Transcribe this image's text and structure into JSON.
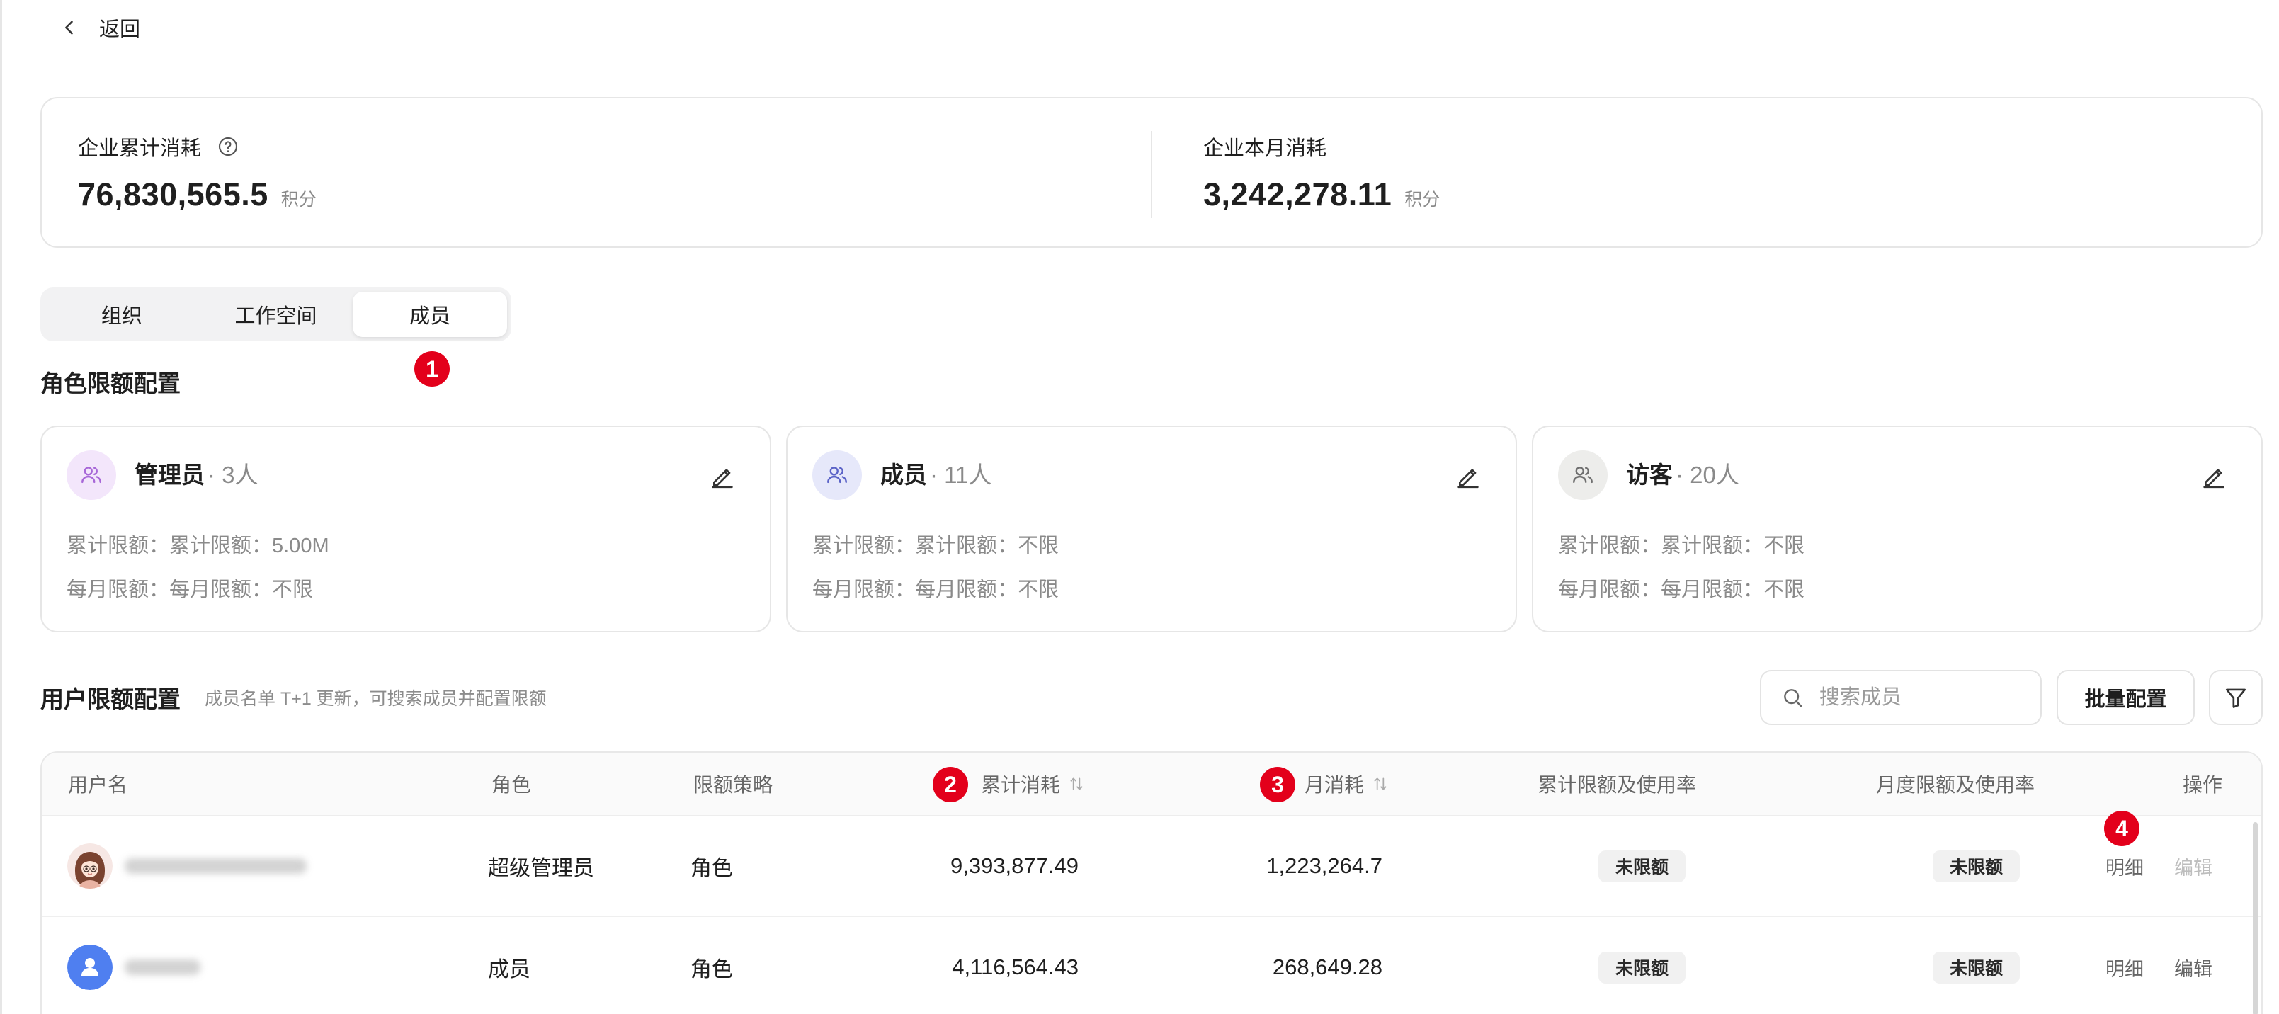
{
  "header": {
    "back_label": "返回",
    "back_icon": "chevron-left-icon"
  },
  "summary": {
    "total": {
      "label": "企业累计消耗",
      "value": "76,830,565.5",
      "unit": "积分",
      "help_icon": "help-circle-icon"
    },
    "monthly": {
      "label": "企业本月消耗",
      "value": "3,242,278.11",
      "unit": "积分"
    }
  },
  "tabs": [
    {
      "label": "组织",
      "active": false
    },
    {
      "label": "工作空间",
      "active": false
    },
    {
      "label": "成员",
      "active": true
    }
  ],
  "roles_section": {
    "title": "角色限额配置"
  },
  "roles": [
    {
      "name": "管理员",
      "count": "· 3人",
      "total_limit": "累计限额：累计限额：5.00M",
      "monthly_limit": "每月限额：每月限额：不限",
      "icon": "users-icon",
      "icon_bg": "#f3e6fb",
      "icon_color": "#a868d8"
    },
    {
      "name": "成员",
      "count": "· 11人",
      "total_limit": "累计限额：累计限额：不限",
      "monthly_limit": "每月限额：每月限额：不限",
      "icon": "users-icon",
      "icon_bg": "#e6e8fa",
      "icon_color": "#5b63c7"
    },
    {
      "name": "访客",
      "count": "· 20人",
      "total_limit": "累计限额：累计限额：不限",
      "monthly_limit": "每月限额：每月限额：不限",
      "icon": "users-icon",
      "icon_bg": "#ededeb",
      "icon_color": "#6f6f6f"
    }
  ],
  "users_section": {
    "title": "用户限额配置",
    "subtitle": "成员名单 T+1 更新，可搜索成员并配置限额",
    "search_placeholder": "搜索成员",
    "batch_button": "批量配置",
    "filter_icon": "filter-icon"
  },
  "table": {
    "columns": {
      "username": "用户名",
      "role": "角色",
      "policy": "限额策略",
      "total_usage": "累计消耗",
      "monthly_usage": "月消耗",
      "total_limit": "累计限额及使用率",
      "monthly_limit": "月度限额及使用率",
      "actions": "操作",
      "sort_icon": "sort-arrows-icon"
    },
    "rows": [
      {
        "avatar": "cartoon-avatar-icon",
        "role": "超级管理员",
        "policy": "角色",
        "total_usage": "9,393,877.49",
        "monthly_usage": "1,223,264.7",
        "total_limit": "未限额",
        "monthly_limit": "未限额",
        "detail": "明细",
        "edit": "编辑",
        "edit_disabled": true
      },
      {
        "avatar": "default-user-avatar-icon",
        "role": "成员",
        "policy": "角色",
        "total_usage": "4,116,564.43",
        "monthly_usage": "268,649.28",
        "total_limit": "未限额",
        "monthly_limit": "未限额",
        "detail": "明细",
        "edit": "编辑",
        "edit_disabled": false
      }
    ]
  },
  "annotations": [
    "1",
    "2",
    "3",
    "4"
  ],
  "colors": {
    "annotation": "#e3001b",
    "border": "#e6e6e6",
    "text_muted": "#8a8a8a",
    "avatar_default": "#4f7ff0"
  }
}
